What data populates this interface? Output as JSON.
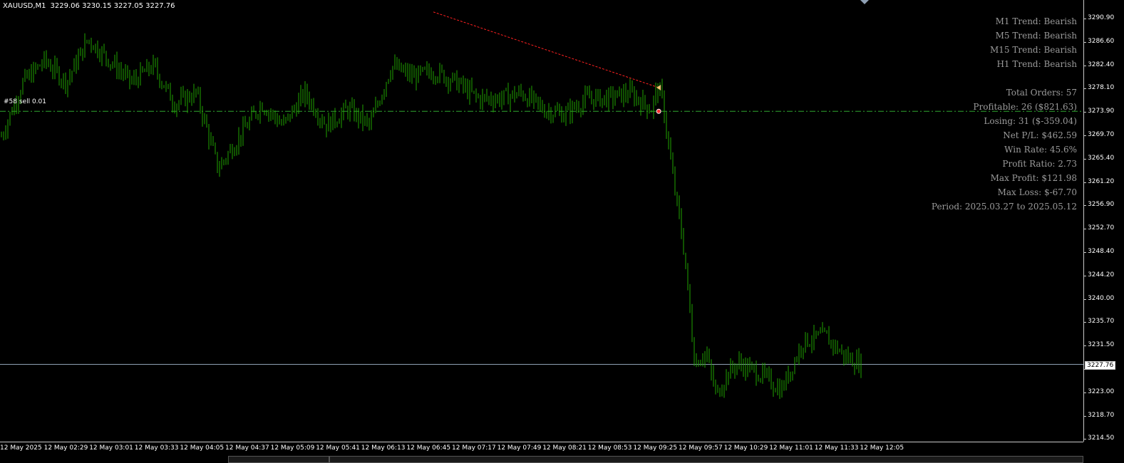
{
  "header": {
    "symbol": "XAUUSD,M1",
    "ohlc": "3229.06 3230.15 3227.05 3227.76"
  },
  "stats": {
    "m1": "M1 Trend: Bearish",
    "m5": "M5 Trend: Bearish",
    "m15": "M15 Trend: Bearish",
    "h1": "H1 Trend: Bearish",
    "total_orders": "Total Orders: 57",
    "profitable": "Profitable: 26 ($821.63)",
    "losing": "Losing: 31 ($-359.04)",
    "net_pl": "Net P/L: $462.59",
    "win_rate": "Win Rate: 45.6%",
    "profit_ratio": "Profit Ratio: 2.73",
    "max_profit": "Max Profit: $121.98",
    "max_loss": "Max Loss: $-67.70",
    "period": "Period: 2025.03.27 to 2025.05.12"
  },
  "order_label": "#58 sell 0.01",
  "current_price": "3227.76",
  "y_ticks": [
    "3290.90",
    "3286.60",
    "3282.40",
    "3278.10",
    "3273.90",
    "3269.70",
    "3265.40",
    "3261.20",
    "3256.90",
    "3252.70",
    "3248.40",
    "3244.20",
    "3240.00",
    "3235.70",
    "3231.50",
    "3227.76",
    "3223.00",
    "3218.70",
    "3214.50"
  ],
  "x_ticks": [
    "12 May 2025",
    "12 May 02:29",
    "12 May 03:01",
    "12 May 03:33",
    "12 May 04:05",
    "12 May 04:37",
    "12 May 05:09",
    "12 May 05:41",
    "12 May 06:13",
    "12 May 06:45",
    "12 May 07:17",
    "12 May 07:49",
    "12 May 08:21",
    "12 May 08:53",
    "12 May 09:25",
    "12 May 09:57",
    "12 May 10:29",
    "12 May 11:01",
    "12 May 11:33",
    "12 May 12:05"
  ],
  "colors": {
    "background": "#000000",
    "bars": "#21a300",
    "order_line": "#2fa52f",
    "price_line": "#8fa0b4",
    "trend_line": "#ff2020",
    "stats_text": "#9a9a9a"
  },
  "chart_data": {
    "type": "line",
    "ylim": [
      3214.5,
      3293.0
    ],
    "order_price": 3274.6,
    "current_price": 3227.76,
    "trend_line": {
      "x": [
        0.4,
        0.608
      ],
      "y": [
        3293.0,
        3279.0
      ]
    },
    "x": [
      0,
      0.02,
      0.04,
      0.06,
      0.08,
      0.1,
      0.12,
      0.14,
      0.16,
      0.18,
      0.2,
      0.22,
      0.24,
      0.26,
      0.28,
      0.3,
      0.32,
      0.34,
      0.36,
      0.38,
      0.4,
      0.42,
      0.44,
      0.46,
      0.48,
      0.5,
      0.52,
      0.54,
      0.56,
      0.58,
      0.6,
      0.605,
      0.61,
      0.62,
      0.63,
      0.64,
      0.65,
      0.66,
      0.67,
      0.68,
      0.7,
      0.72,
      0.74,
      0.76,
      0.78,
      0.795
    ],
    "close": [
      3270,
      3280,
      3284,
      3280,
      3288,
      3284,
      3280,
      3283,
      3276,
      3278,
      3264,
      3270,
      3276,
      3272,
      3278,
      3272,
      3275,
      3272,
      3283,
      3281,
      3282,
      3280,
      3277,
      3277,
      3278,
      3275,
      3274,
      3277,
      3277,
      3278,
      3275,
      3279,
      3277,
      3262,
      3249,
      3228,
      3230,
      3222,
      3226,
      3228,
      3226,
      3223,
      3232,
      3233,
      3229,
      3227.76
    ]
  }
}
